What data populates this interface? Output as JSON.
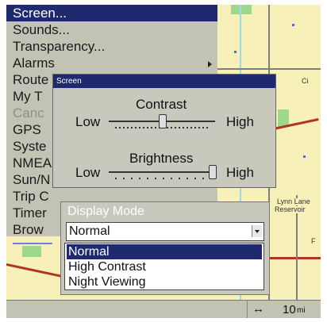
{
  "menu": {
    "items": [
      {
        "label": "Screen...",
        "selected": true,
        "dim": false
      },
      {
        "label": "Sounds...",
        "dim": false
      },
      {
        "label": "Transparency...",
        "dim": false
      },
      {
        "label": "Alarms",
        "dim": false,
        "submenu": true
      },
      {
        "label": "Route",
        "dim": false
      },
      {
        "label": "My T",
        "dim": false
      },
      {
        "label": "Canc",
        "dim": true
      },
      {
        "label": "GPS",
        "dim": false
      },
      {
        "label": "Syste",
        "dim": false
      },
      {
        "label": "NMEA",
        "dim": false
      },
      {
        "label": "Sun/N",
        "dim": false
      },
      {
        "label": "Trip C",
        "dim": false
      },
      {
        "label": "Timer",
        "dim": false
      },
      {
        "label": "Brow",
        "dim": false
      }
    ]
  },
  "screen_dialog": {
    "title": "Screen",
    "contrast": {
      "label": "Contrast",
      "low": "Low",
      "high": "High",
      "level": 0.5
    },
    "brightness": {
      "label": "Brightness",
      "low": "Low",
      "high": "High",
      "level": 0.97
    }
  },
  "display_mode": {
    "label": "Display Mode",
    "selected": "Normal",
    "options": [
      "Normal",
      "High Contrast",
      "Night Viewing"
    ]
  },
  "map": {
    "labels": [
      "Ci",
      "Lynn Lane",
      "Reservoir",
      "F"
    ]
  },
  "status": {
    "scale_icon": "↔",
    "scale_value": "10",
    "scale_unit": "mi"
  },
  "colors": {
    "accent": "#1f2a6e",
    "panel": "#c3c3b5",
    "map_bg": "#f7f0b8",
    "road_red": "#b0341e",
    "park": "#9fd88a"
  }
}
